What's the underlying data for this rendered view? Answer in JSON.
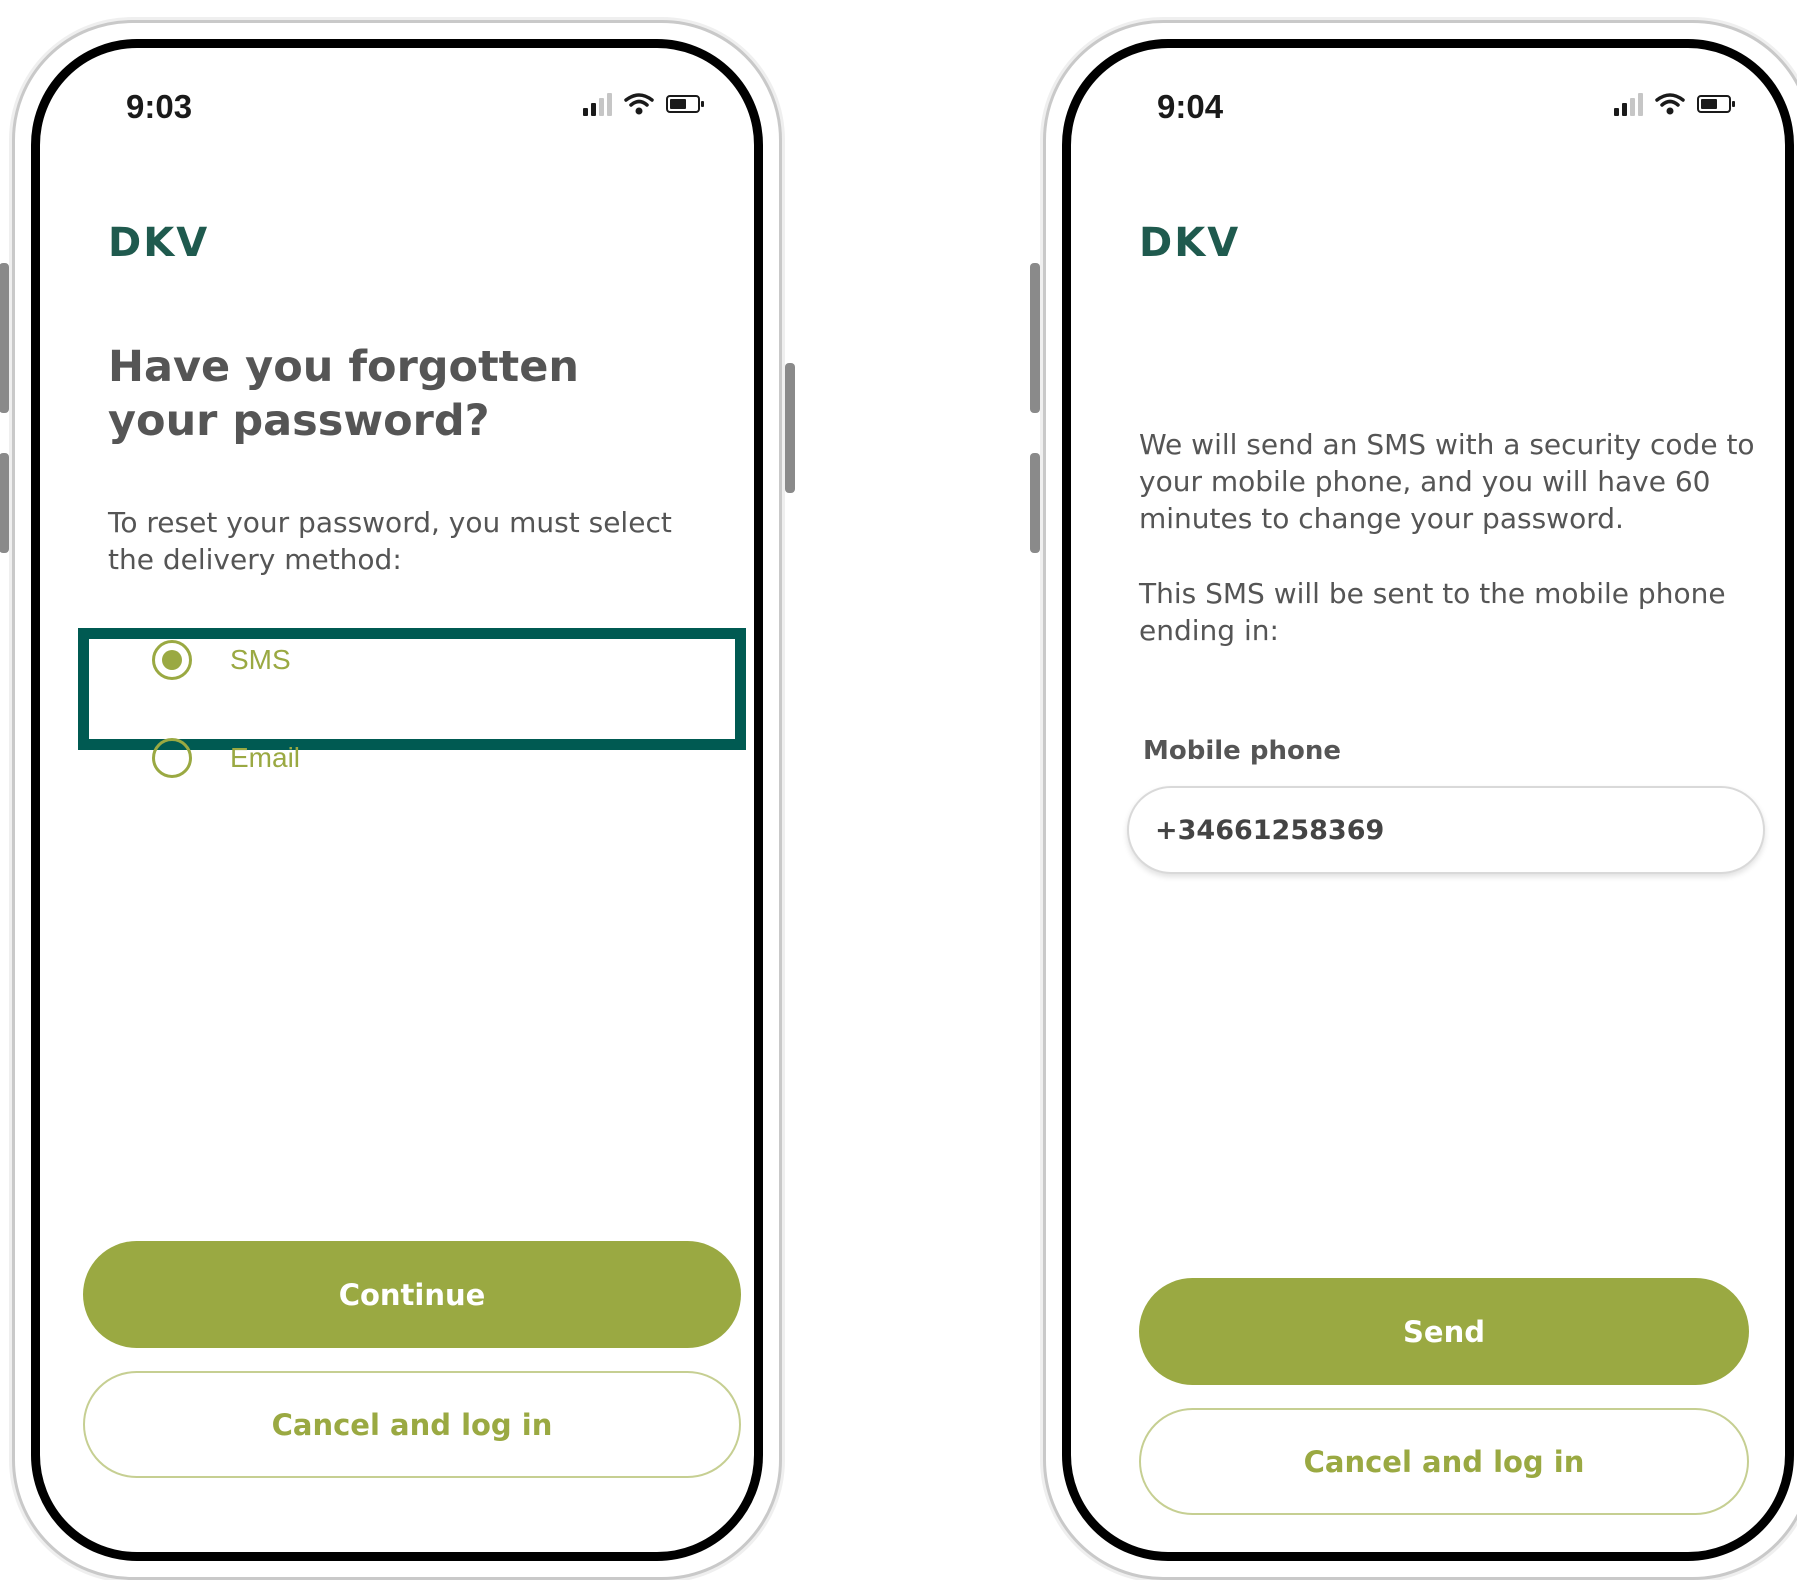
{
  "colors": {
    "brand_green": "#9aa942",
    "logo_green": "#1f5a4e",
    "highlight_teal": "#005a52",
    "text_gray": "#555555"
  },
  "screen1": {
    "status": {
      "time": "9:03"
    },
    "logo": "DKV",
    "title": "Have you forgotten your password?",
    "subtitle": "To reset your password, you must select the delivery method:",
    "options": [
      {
        "label": "SMS",
        "selected": true
      },
      {
        "label": "Email",
        "selected": false
      }
    ],
    "continue_label": "Continue",
    "cancel_label": "Cancel and log in"
  },
  "screen2": {
    "status": {
      "time": "9:04"
    },
    "logo": "DKV",
    "info": "We will send an SMS with a security code to your mobile phone, and you will have 60 minutes to change your password.",
    "info2": "This SMS will be sent to the mobile phone ending in:",
    "field_label": "Mobile phone",
    "phone_value": "+34661258369",
    "send_label": "Send",
    "cancel_label": "Cancel and log in"
  }
}
